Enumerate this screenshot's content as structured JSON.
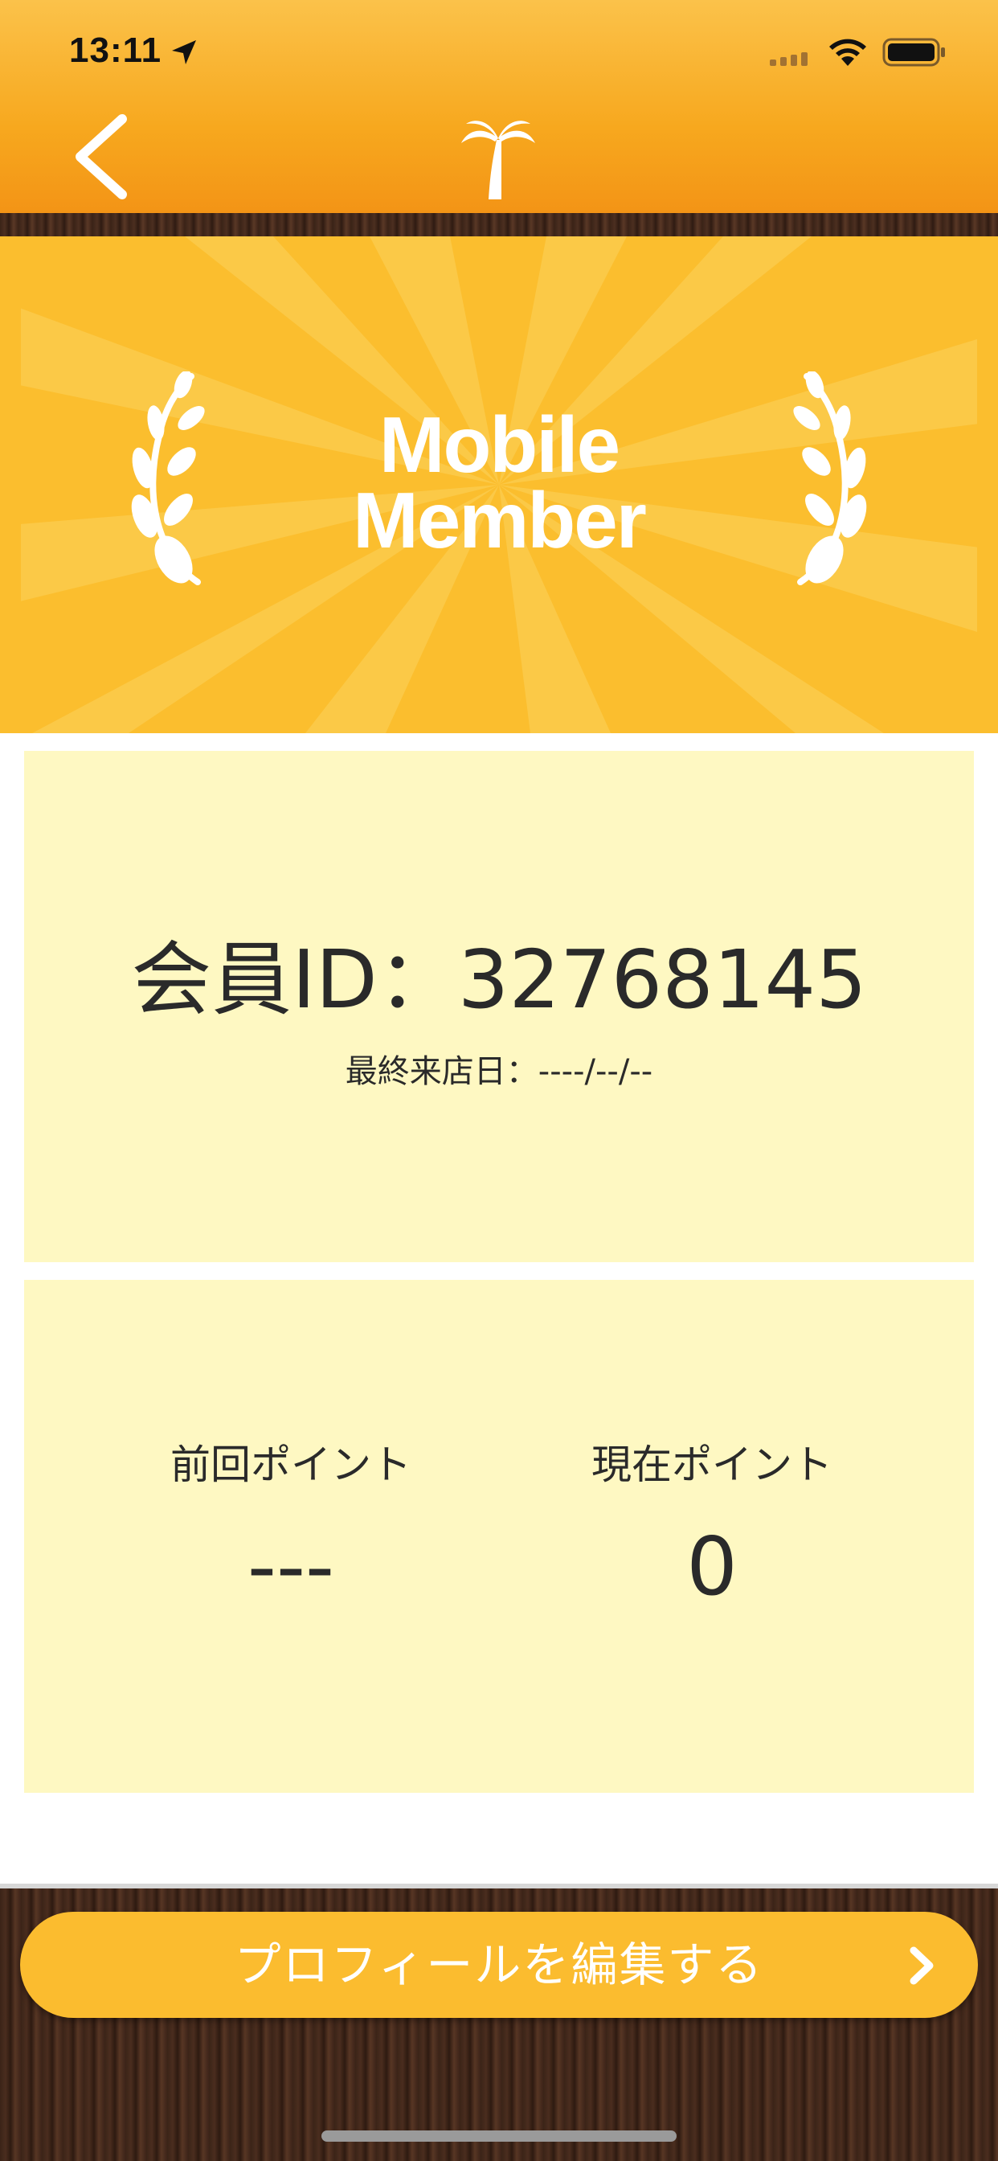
{
  "status_bar": {
    "time": "13:11"
  },
  "header": {
    "back_icon": "chevron-left-icon",
    "logo_icon": "palm-tree-icon"
  },
  "banner": {
    "title_line1": "Mobile",
    "title_line2": "Member",
    "background_color": "#fbbe2e"
  },
  "member_card": {
    "id_label": "会員ID：",
    "id_value": "32768145",
    "last_visit_label": "最終来店日：",
    "last_visit_value": "----/--/--"
  },
  "points_card": {
    "previous_label": "前回ポイント",
    "previous_value": "---",
    "current_label": "現在ポイント",
    "current_value": "0"
  },
  "footer": {
    "edit_profile_label": "プロフィールを編集する",
    "button_color": "#fbbc2f"
  }
}
